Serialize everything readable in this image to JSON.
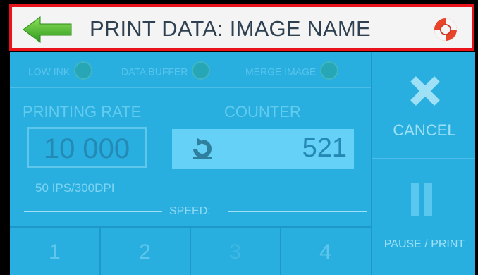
{
  "header": {
    "title": "PRINT DATA: IMAGE NAME"
  },
  "status": {
    "low_ink": "LOW INK",
    "data_buffer": "DATA BUFFER",
    "merge_image": "MERGE IMAGE"
  },
  "printing_rate": {
    "label": "PRINTING RATE",
    "value": "10 000",
    "info": "50 IPS/300DPI"
  },
  "counter": {
    "label": "COUNTER",
    "value": "521"
  },
  "speed": {
    "label": "SPEED:",
    "options": [
      "1",
      "2",
      "3",
      "4"
    ]
  },
  "actions": {
    "cancel": "CANCEL",
    "pause_print": "PAUSE / PRINT"
  },
  "colors": {
    "panel": "#29aee0",
    "header_border": "#e8131b",
    "back_arrow": "#4cb532",
    "indicator": "#27a6b6"
  }
}
